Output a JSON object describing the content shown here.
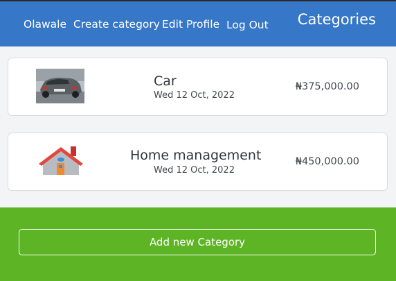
{
  "nav": {
    "links": [
      "Olawale",
      "Create category",
      "Edit Profile",
      "Log Out"
    ],
    "title": "Categories"
  },
  "categories": [
    {
      "name": "Car",
      "date": "Wed 12 Oct, 2022",
      "amount": "₦375,000.00",
      "icon": "car-photo"
    },
    {
      "name": "Home management",
      "date": "Wed 12 Oct, 2022",
      "amount": "₦450,000.00",
      "icon": "house-icon"
    }
  ],
  "footer": {
    "add_label": "Add new Category"
  },
  "colors": {
    "header": "#3777c8",
    "footer": "#5db526",
    "background": "#f3f4f6"
  }
}
